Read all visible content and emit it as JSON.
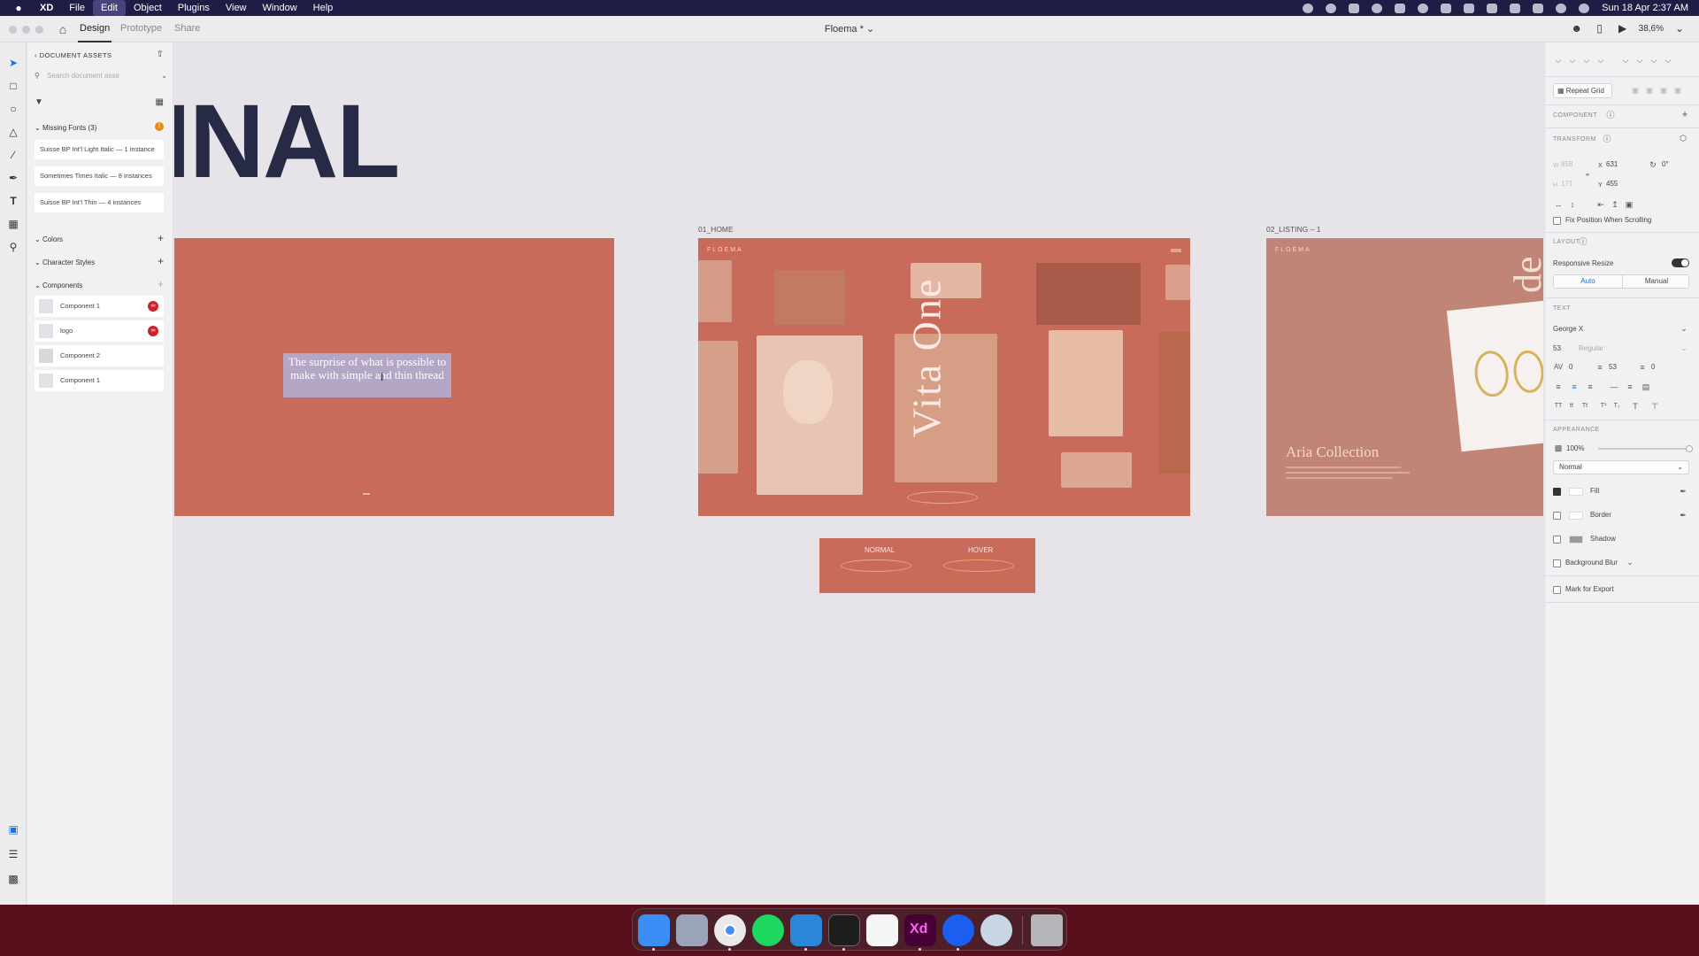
{
  "menubar": {
    "apple": "",
    "app": "XD",
    "items": [
      "File",
      "Edit",
      "Object",
      "Plugins",
      "View",
      "Window",
      "Help"
    ],
    "active_item": "Edit",
    "clock": "Sun 18 Apr  2:37 AM"
  },
  "window": {
    "tabs": [
      "Design",
      "Prototype",
      "Share"
    ],
    "active_tab": "Design",
    "doc_title": "Floema *",
    "zoom": "38,6%"
  },
  "assets": {
    "header": "DOCUMENT ASSETS",
    "search_placeholder": "Search document asse",
    "missing_fonts_title": "Missing Fonts (3)",
    "missing_fonts": [
      "Suisse BP Int'l Light Italic — 1 instance",
      "Sometimes Times Italic — 8 instances",
      "Suisse BP Int'l Thin — 4 instances"
    ],
    "colors_title": "Colors",
    "char_styles_title": "Character Styles",
    "components_title": "Components",
    "components": [
      "Component 1",
      "logo",
      "Component 2",
      "Component 1"
    ]
  },
  "canvas": {
    "big_title": "INAL",
    "artboard_home_label": "01_HOME",
    "artboard_listing_label": "02_LISTING – 1",
    "brand": "FLOEMA",
    "selected_text": "The surprise of what is possible to make with simple and thin thread",
    "vita": "Vita One",
    "listing_title": "Aria Collection",
    "listing_side": "de",
    "button_normal": "NORMAL",
    "button_hover": "HOVER"
  },
  "props": {
    "repeat_grid": "Repeat Grid",
    "component": "COMPONENT",
    "transform": "TRANSFORM",
    "w_label": "W",
    "w": "858",
    "x_label": "X",
    "x": "631",
    "rotation": "0°",
    "h_label": "H",
    "h": "171",
    "y_label": "Y",
    "y": "455",
    "fix_position": "Fix Position When Scrolling",
    "layout": "LAYOUT",
    "responsive_resize": "Responsive Resize",
    "auto": "Auto",
    "manual": "Manual",
    "text": "TEXT",
    "font": "George X",
    "font_size": "53",
    "font_weight": "Regular",
    "char_spacing": "0",
    "line_spacing": "53",
    "para_spacing": "0",
    "appearance": "APPEARANCE",
    "opacity": "100%",
    "blend": "Normal",
    "fill": "Fill",
    "border": "Border",
    "shadow": "Shadow",
    "background_blur": "Background Blur",
    "mark_export": "Mark for Export"
  },
  "colors": {
    "artboard": "#c86b5b",
    "title": "#262a44",
    "selection": "#b0b4de",
    "menubar": "#1f1d46"
  }
}
